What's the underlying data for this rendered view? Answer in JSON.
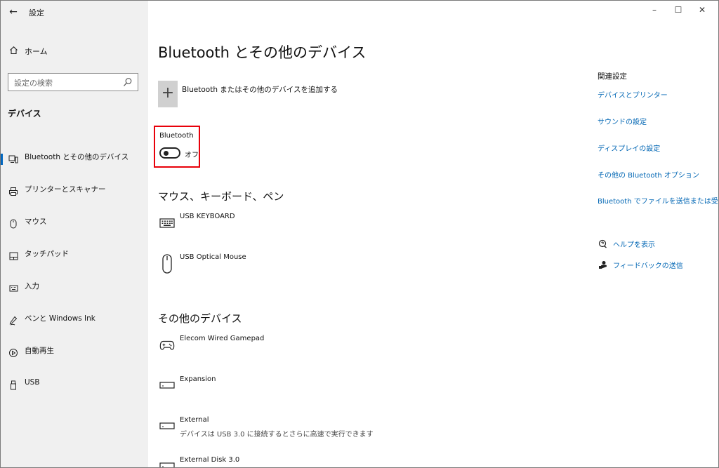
{
  "window": {
    "title": "設定",
    "back_icon": "back-arrow-icon"
  },
  "window_controls": {
    "minimize": "–",
    "maximize": "☐",
    "close": "✕"
  },
  "sidebar": {
    "home_label": "ホーム",
    "search_placeholder": "設定の検索",
    "section_title": "デバイス",
    "items": [
      {
        "label": "Bluetooth とその他のデバイス",
        "icon": "bluetooth-devices-icon",
        "active": true
      },
      {
        "label": "プリンターとスキャナー",
        "icon": "printer-icon"
      },
      {
        "label": "マウス",
        "icon": "mouse-icon"
      },
      {
        "label": "タッチパッド",
        "icon": "touchpad-icon"
      },
      {
        "label": "入力",
        "icon": "keyboard-icon"
      },
      {
        "label": "ペンと Windows Ink",
        "icon": "pen-icon"
      },
      {
        "label": "自動再生",
        "icon": "autoplay-icon"
      },
      {
        "label": "USB",
        "icon": "usb-icon"
      }
    ]
  },
  "main": {
    "title": "Bluetooth とその他のデバイス",
    "add_button": {
      "symbol": "+",
      "label": "Bluetooth またはその他のデバイスを追加する"
    },
    "bluetooth": {
      "label": "Bluetooth",
      "state": "オフ",
      "on": false
    },
    "sections": [
      {
        "title": "マウス、キーボード、ペン",
        "devices": [
          {
            "name": "USB KEYBOARD",
            "icon": "keyboard-icon"
          },
          {
            "name": "USB Optical Mouse",
            "icon": "mouse-icon"
          }
        ]
      },
      {
        "title": "その他のデバイス",
        "devices": [
          {
            "name": "Elecom Wired Gamepad",
            "icon": "gamepad-icon"
          },
          {
            "name": "Expansion",
            "icon": "drive-icon"
          },
          {
            "name": "External",
            "icon": "drive-icon",
            "sub": "デバイスは USB 3.0 に接続するとさらに高速で実行できます"
          },
          {
            "name": "External Disk 3.0",
            "icon": "drive-icon"
          }
        ]
      }
    ]
  },
  "related": {
    "title": "関連設定",
    "links": [
      "デバイスとプリンター",
      "サウンドの設定",
      "ディスプレイの設定",
      "その他の Bluetooth オプション",
      "Bluetooth でファイルを送信または受信する"
    ],
    "help": {
      "label": "ヘルプを表示",
      "icon": "help-chat-icon"
    },
    "feedback": {
      "label": "フィードバックの送信",
      "icon": "feedback-icon"
    }
  }
}
